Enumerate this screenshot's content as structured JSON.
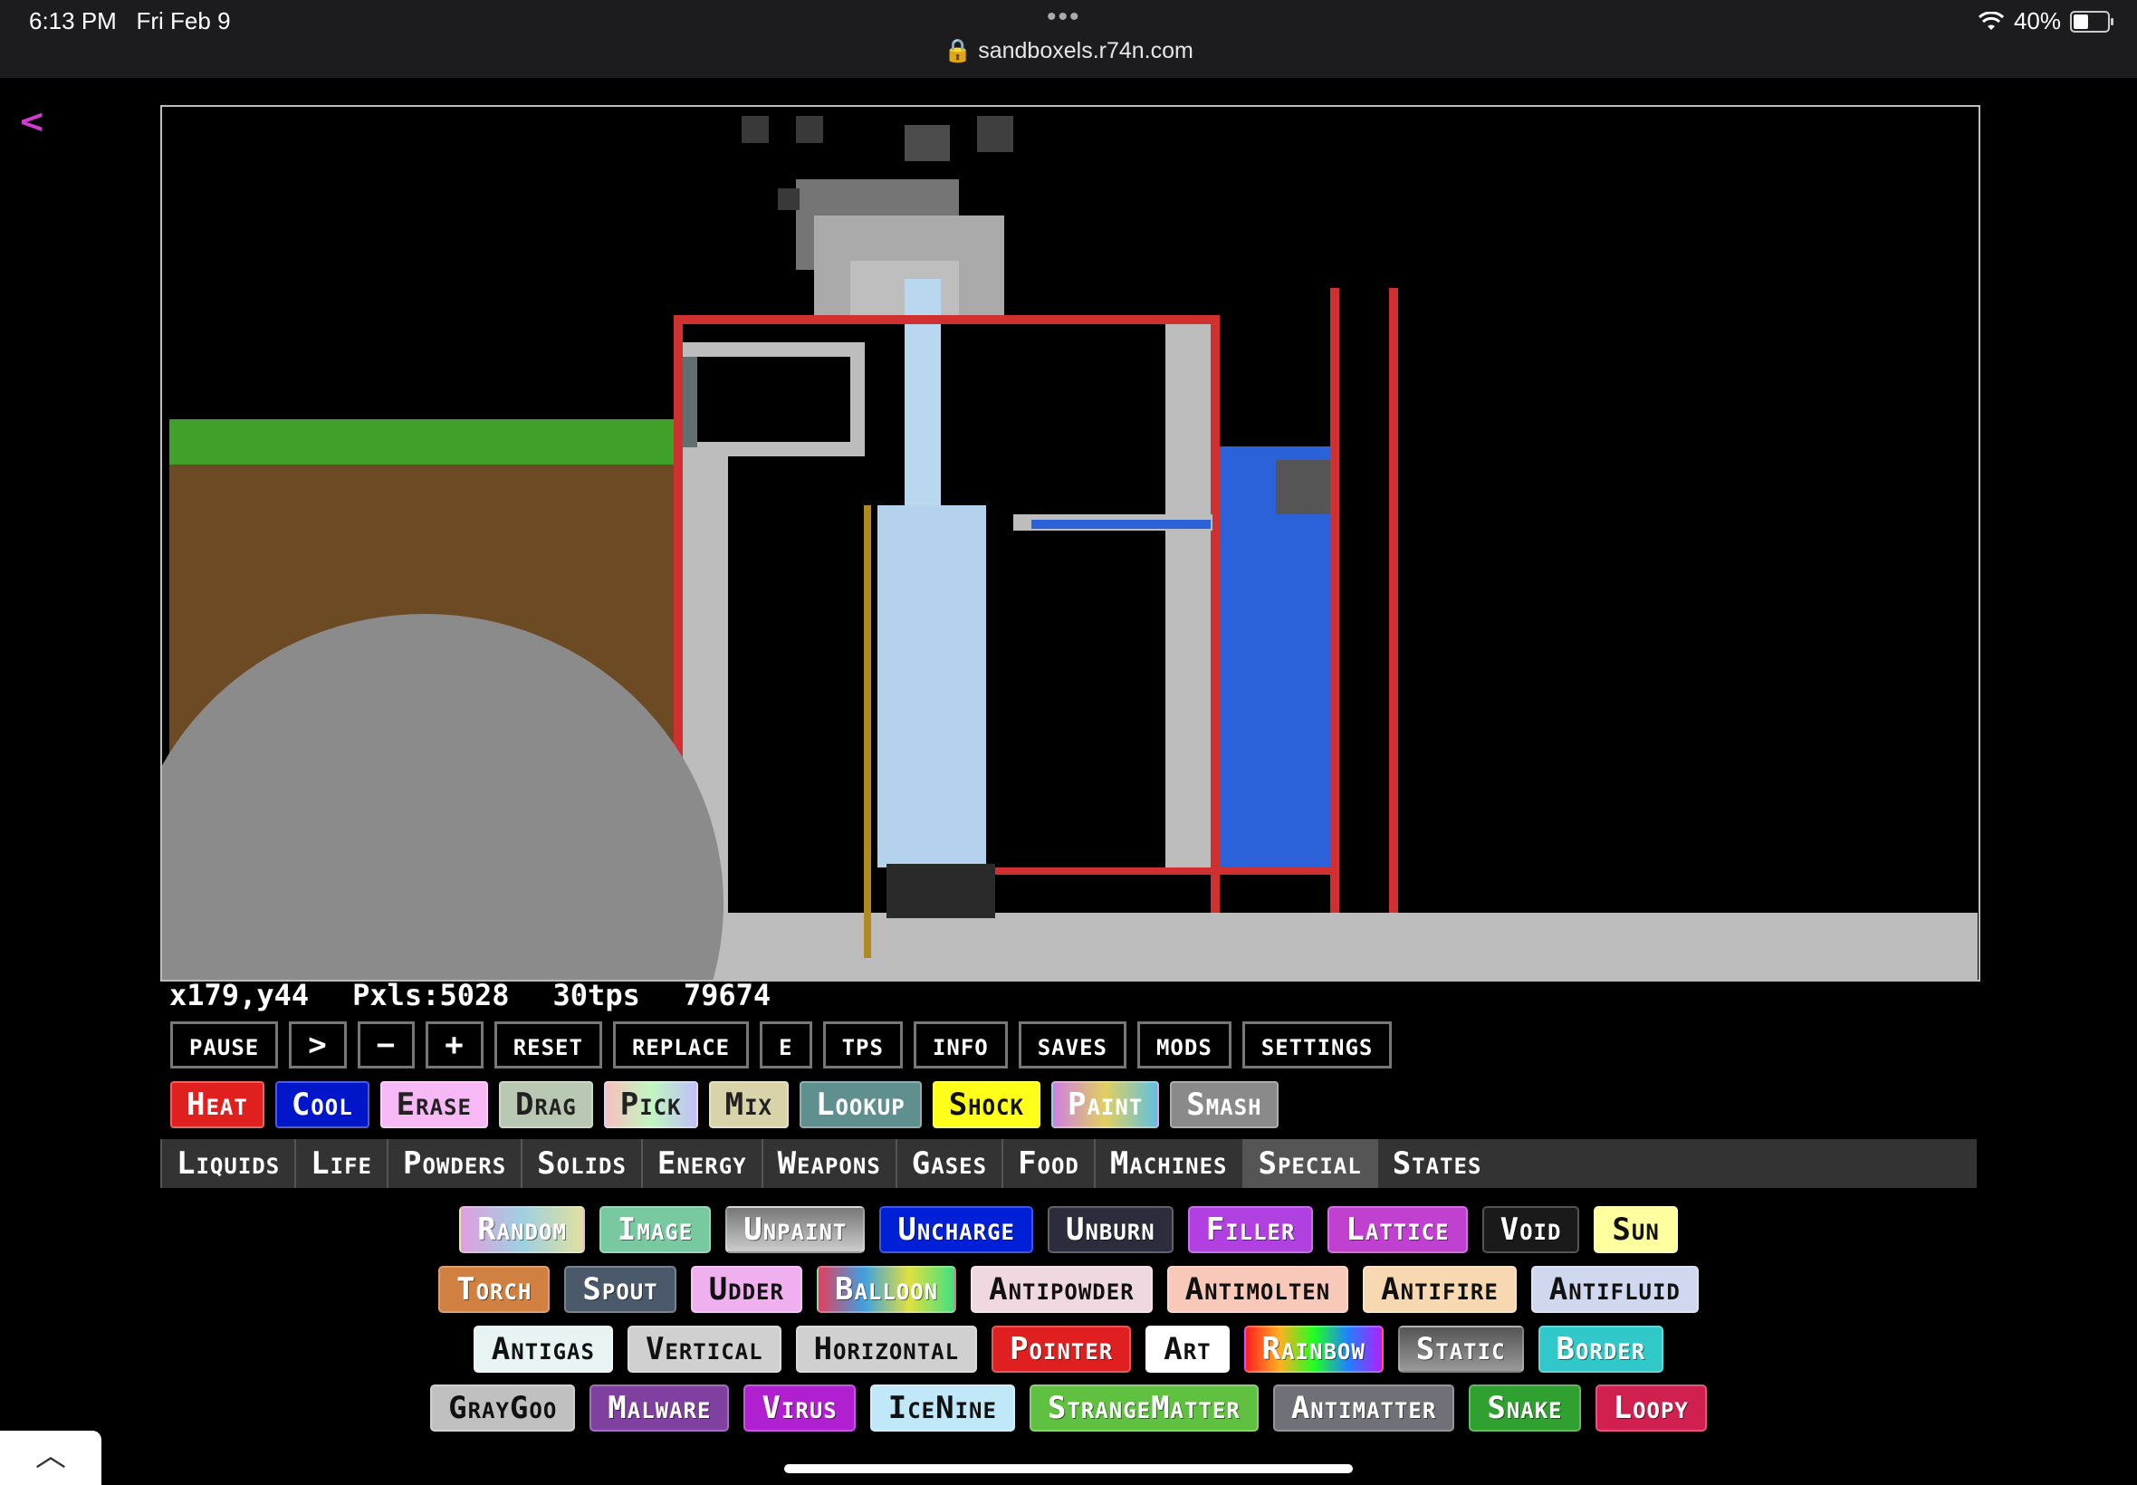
{
  "status_bar": {
    "time": "6:13 PM",
    "date": "Fri Feb 9",
    "dots": "•••",
    "url": "sandboxels.r74n.com",
    "battery": "40%"
  },
  "back_icon": "chevron-left",
  "stats": {
    "coords": "x179,y44",
    "pixels": "Pxls:5028",
    "tps": "30tps",
    "count": "79674"
  },
  "controls": [
    "Pause",
    ">",
    "−",
    "+",
    "Reset",
    "Replace",
    "E",
    "Tps",
    "Info",
    "Saves",
    "Mods",
    "Settings"
  ],
  "tools": [
    {
      "label": "Heat",
      "bg": "#e0201e",
      "fg": "#ffffff"
    },
    {
      "label": "Cool",
      "bg": "#0016c8",
      "fg": "#ffffff"
    },
    {
      "label": "Erase",
      "bg": "#f6b9f6",
      "fg": "#222222"
    },
    {
      "label": "Drag",
      "bg": "#b9c8b2",
      "fg": "#222222"
    },
    {
      "label": "Pick",
      "bg": "linear-gradient(90deg,#f7c0c0,#c0f7c0,#c0c0f7)",
      "fg": "#222222"
    },
    {
      "label": "Mix",
      "bg": "#d8d3a8",
      "fg": "#222222"
    },
    {
      "label": "Lookup",
      "bg": "#5f8f8f",
      "fg": "#ffffff"
    },
    {
      "label": "Shock",
      "bg": "#ffff1a",
      "fg": "#111111"
    },
    {
      "label": "Paint",
      "bg": "linear-gradient(90deg,#d080e0,#e0d060,#60c0e0)",
      "fg": "#ffffff"
    },
    {
      "label": "Smash",
      "bg": "#8a8a8a",
      "fg": "#ffffff"
    }
  ],
  "tabs": [
    "Liquids",
    "Life",
    "Powders",
    "Solids",
    "Energy",
    "Weapons",
    "Gases",
    "Food",
    "Machines",
    "Special",
    "States"
  ],
  "active_tab": "Special",
  "elements": [
    [
      {
        "label": "Random",
        "bg": "linear-gradient(90deg,#e09ee0,#9ed0e0,#e0e09e)"
      },
      {
        "label": "Image",
        "bg": "#78c8a0"
      },
      {
        "label": "Unpaint",
        "bg": "linear-gradient(180deg,#777,#ccc)"
      },
      {
        "label": "Uncharge",
        "bg": "#0020d8"
      },
      {
        "label": "Unburn",
        "bg": "#2c2c3c"
      },
      {
        "label": "Filler",
        "bg": "#b040e0"
      },
      {
        "label": "Lattice",
        "bg": "#c040d0"
      },
      {
        "label": "Void",
        "bg": "#1a1a1a"
      },
      {
        "label": "Sun",
        "bg": "#ffffa0",
        "dark": true
      }
    ],
    [
      {
        "label": "Torch",
        "bg": "#d08040"
      },
      {
        "label": "Spout",
        "bg": "#4a5a6a"
      },
      {
        "label": "Udder",
        "bg": "#f0b0f0",
        "dark": true
      },
      {
        "label": "Balloon",
        "bg": "linear-gradient(90deg,#e04060,#40a0e0,#e0e040,#40e080)"
      },
      {
        "label": "Antipowder",
        "bg": "#f0d8e0",
        "dark": true
      },
      {
        "label": "Antimolten",
        "bg": "#f8c8b8",
        "dark": true
      },
      {
        "label": "Antifire",
        "bg": "#f8d8b0",
        "dark": true
      },
      {
        "label": "Antifluid",
        "bg": "#d0d8f0",
        "dark": true
      }
    ],
    [
      {
        "label": "Antigas",
        "bg": "#e8f4f4",
        "dark": true
      },
      {
        "label": "Vertical",
        "bg": "#d0d0d0",
        "dark": true
      },
      {
        "label": "Horizontal",
        "bg": "#d0d0d0",
        "dark": true
      },
      {
        "label": "Pointer",
        "bg": "#e02020"
      },
      {
        "label": "Art",
        "bg": "#ffffff",
        "dark": true
      },
      {
        "label": "Rainbow",
        "bg": "linear-gradient(90deg,#ff2020,#ffb020,#20ff20,#2080ff,#b020ff)"
      },
      {
        "label": "Static",
        "bg": "linear-gradient(180deg,#555,#999)"
      },
      {
        "label": "Border",
        "bg": "#30c8c8"
      }
    ],
    [
      {
        "label": "GrayGoo",
        "bg": "#c0c0c0",
        "dark": true
      },
      {
        "label": "Malware",
        "bg": "#8040a0"
      },
      {
        "label": "Virus",
        "bg": "#b020d0"
      },
      {
        "label": "IceNine",
        "bg": "#c0e8f8",
        "dark": true
      },
      {
        "label": "StrangeMatter",
        "bg": "#60c040"
      },
      {
        "label": "Antimatter",
        "bg": "#707078"
      },
      {
        "label": "Snake",
        "bg": "#30a030"
      },
      {
        "label": "Loopy",
        "bg": "#d02050"
      }
    ]
  ],
  "bottom_tab_icon": "chevron-up"
}
